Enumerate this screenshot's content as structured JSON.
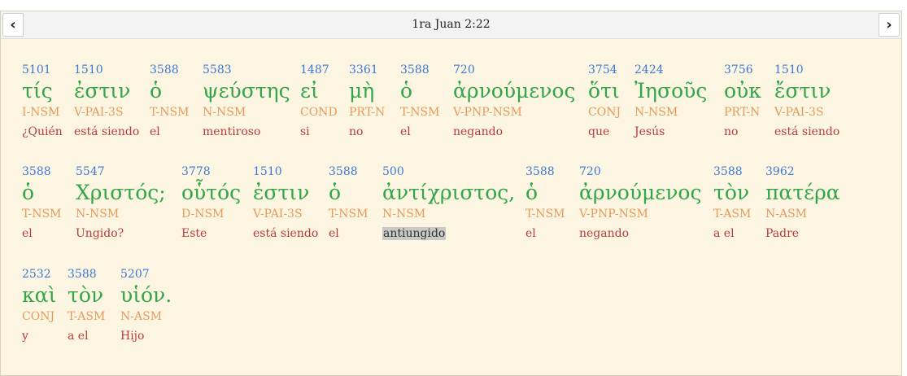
{
  "header": {
    "title": "1ra Juan 2:22",
    "prev_label": "<",
    "next_label": ">"
  },
  "rows": [
    [
      {
        "num": "5101",
        "greek": "τίς",
        "parse": "I-NSM",
        "gloss": "¿Quién"
      },
      {
        "num": "1510",
        "greek": "ἐστιν",
        "parse": "V-PAI-3S",
        "gloss": "está siendo"
      },
      {
        "num": "3588",
        "greek": "ὁ",
        "parse": "T-NSM",
        "gloss": "el"
      },
      {
        "num": "5583",
        "greek": "ψεύστης",
        "parse": "N-NSM",
        "gloss": "mentiroso"
      },
      {
        "num": "1487",
        "greek": "εἰ",
        "parse": "COND",
        "gloss": "si"
      },
      {
        "num": "3361",
        "greek": "μὴ",
        "parse": "PRT-N",
        "gloss": "no"
      },
      {
        "num": "3588",
        "greek": "ὁ",
        "parse": "T-NSM",
        "gloss": "el"
      },
      {
        "num": "720",
        "greek": "ἀρνούμενος",
        "parse": "V-PNP-NSM",
        "gloss": "negando"
      },
      {
        "num": "3754",
        "greek": "ὅτι",
        "parse": "CONJ",
        "gloss": "que"
      },
      {
        "num": "2424",
        "greek": "Ἰησοῦς",
        "parse": "N-NSM",
        "gloss": "Jesús"
      },
      {
        "num": "3756",
        "greek": "οὐκ",
        "parse": "PRT-N",
        "gloss": "no"
      },
      {
        "num": "1510",
        "greek": "ἔστιν",
        "parse": "V-PAI-3S",
        "gloss": "está siendo"
      }
    ],
    [
      {
        "num": "3588",
        "greek": "ὁ",
        "parse": "T-NSM",
        "gloss": "el"
      },
      {
        "num": "5547",
        "greek": "Χριστός;",
        "parse": "N-NSM",
        "gloss": "Ungido?"
      },
      {
        "num": "3778",
        "greek": "οὗτός",
        "parse": "D-NSM",
        "gloss": "Este"
      },
      {
        "num": "1510",
        "greek": "ἐστιν",
        "parse": "V-PAI-3S",
        "gloss": "está siendo"
      },
      {
        "num": "3588",
        "greek": "ὁ",
        "parse": "T-NSM",
        "gloss": "el"
      },
      {
        "num": "500",
        "greek": "ἀντίχριστος,",
        "parse": "N-NSM",
        "gloss": "antiungido",
        "selected": true
      },
      {
        "num": "3588",
        "greek": "ὁ",
        "parse": "T-NSM",
        "gloss": "el"
      },
      {
        "num": "720",
        "greek": "ἀρνούμενος",
        "parse": "V-PNP-NSM",
        "gloss": "negando"
      },
      {
        "num": "3588",
        "greek": "τὸν",
        "parse": "T-ASM",
        "gloss": "a el"
      },
      {
        "num": "3962",
        "greek": "πατέρα",
        "parse": "N-ASM",
        "gloss": "Padre"
      }
    ],
    [
      {
        "num": "2532",
        "greek": "καὶ",
        "parse": "CONJ",
        "gloss": "y"
      },
      {
        "num": "3588",
        "greek": "τὸν",
        "parse": "T-ASM",
        "gloss": "a el"
      },
      {
        "num": "5207",
        "greek": "υἱόν.",
        "parse": "N-ASM",
        "gloss": "Hijo"
      }
    ]
  ]
}
